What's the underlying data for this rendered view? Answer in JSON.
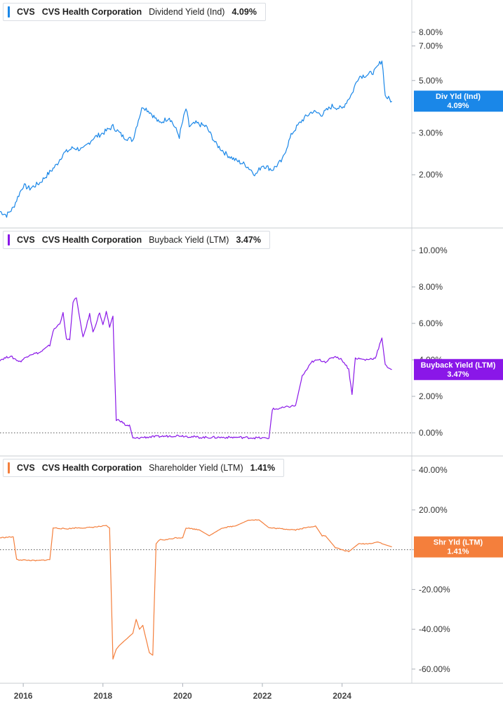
{
  "panels": [
    {
      "ticker": "CVS",
      "company": "CVS Health Corporation",
      "metric": "Dividend Yield (Ind)",
      "value": "4.09%",
      "badge_line1": "Div Yld (Ind)",
      "badge_line2": "4.09%",
      "color": "#1a87e8",
      "swatch_color": "#1a87e8"
    },
    {
      "ticker": "CVS",
      "company": "CVS Health Corporation",
      "metric": "Buyback Yield (LTM)",
      "value": "3.47%",
      "badge_line1": "Buyback Yield (LTM)",
      "badge_line2": "3.47%",
      "color": "#8a17e8",
      "swatch_color": "#8a17e8"
    },
    {
      "ticker": "CVS",
      "company": "CVS Health Corporation",
      "metric": "Shareholder Yield (LTM)",
      "value": "1.41%",
      "badge_line1": "Shr Yld (LTM)",
      "badge_line2": "1.41%",
      "color": "#f47f3c",
      "swatch_color": "#f47f3c"
    }
  ],
  "chart_data": [
    {
      "type": "line",
      "scale": "log",
      "title": "CVS   CVS Health Corporation   Dividend Yield (Ind)   4.09%",
      "series": [
        {
          "name": "Dividend Yield (Ind)",
          "x": [
            "2015-06",
            "2015-08",
            "2015-10",
            "2016-01",
            "2016-03",
            "2016-06",
            "2016-09",
            "2016-11",
            "2017-01",
            "2017-04",
            "2017-07",
            "2017-10",
            "2018-01",
            "2018-04",
            "2018-07",
            "2018-10",
            "2019-01",
            "2019-03",
            "2019-06",
            "2019-09",
            "2019-12",
            "2020-02",
            "2020-03",
            "2020-05",
            "2020-08",
            "2020-11",
            "2021-02",
            "2021-05",
            "2021-08",
            "2021-11",
            "2022-01",
            "2022-04",
            "2022-07",
            "2022-10",
            "2023-01",
            "2023-04",
            "2023-07",
            "2023-10",
            "2024-01",
            "2024-04",
            "2024-06",
            "2024-09",
            "2024-11",
            "2025-01",
            "2025-02",
            "2025-04"
          ],
          "values": [
            1.4,
            1.35,
            1.45,
            1.8,
            1.75,
            1.85,
            2.05,
            2.2,
            2.45,
            2.6,
            2.55,
            2.85,
            3.0,
            3.2,
            2.9,
            2.8,
            3.9,
            3.7,
            3.3,
            3.5,
            2.9,
            3.8,
            3.2,
            3.3,
            3.2,
            2.7,
            2.45,
            2.3,
            2.2,
            2.0,
            2.2,
            2.1,
            2.3,
            3.0,
            3.4,
            3.7,
            3.6,
            3.9,
            3.8,
            4.4,
            5.2,
            5.3,
            5.5,
            6.1,
            4.3,
            4.09
          ]
        }
      ],
      "y_ticks": [
        2,
        3,
        5,
        7,
        8
      ],
      "y_tick_labels": [
        "2.00%",
        "3.00%",
        "5.00%",
        "7.00%",
        "8.00%"
      ],
      "ylim": [
        1.25,
        10.5
      ],
      "last_value": 4.09
    },
    {
      "type": "line",
      "scale": "linear",
      "title": "CVS   CVS Health Corporation   Buyback Yield (LTM)   3.47%",
      "series": [
        {
          "name": "Buyback Yield (LTM)",
          "x": [
            "2015-06",
            "2015-09",
            "2015-12",
            "2016-03",
            "2016-06",
            "2016-09",
            "2016-10",
            "2016-12",
            "2017-01",
            "2017-02",
            "2017-03",
            "2017-04",
            "2017-05",
            "2017-07",
            "2017-09",
            "2017-10",
            "2017-12",
            "2018-01",
            "2018-02",
            "2018-03",
            "2018-04",
            "2018-05",
            "2018-06",
            "2018-08",
            "2018-09",
            "2018-10",
            "2018-11",
            "2019-01",
            "2019-06",
            "2019-12",
            "2020-06",
            "2020-12",
            "2021-06",
            "2021-12",
            "2022-03",
            "2022-04",
            "2022-05",
            "2022-08",
            "2022-11",
            "2023-01",
            "2023-04",
            "2023-06",
            "2023-08",
            "2023-11",
            "2024-01",
            "2024-03",
            "2024-04",
            "2024-05",
            "2024-08",
            "2024-11",
            "2025-01",
            "2025-02",
            "2025-04"
          ],
          "values": [
            4.0,
            4.2,
            3.9,
            4.3,
            4.4,
            4.8,
            5.6,
            6.0,
            6.6,
            5.1,
            5.1,
            7.2,
            7.4,
            5.2,
            6.5,
            5.5,
            6.6,
            5.9,
            6.6,
            5.8,
            6.4,
            0.7,
            0.7,
            0.4,
            0.4,
            -0.3,
            -0.3,
            -0.25,
            -0.2,
            -0.15,
            -0.25,
            -0.25,
            -0.25,
            -0.28,
            -0.3,
            1.3,
            1.3,
            1.4,
            1.5,
            3.1,
            3.9,
            4.0,
            3.9,
            4.2,
            4.0,
            3.5,
            2.1,
            4.1,
            4.0,
            4.1,
            5.2,
            3.7,
            3.47
          ]
        }
      ],
      "y_ticks": [
        0,
        2,
        4,
        6,
        8,
        10
      ],
      "y_tick_labels": [
        "0.00%",
        "2.00%",
        "4.00%",
        "6.00%",
        "8.00%",
        "10.00%"
      ],
      "ylim": [
        -1,
        11
      ],
      "zero_line": true,
      "last_value": 3.47
    },
    {
      "type": "line",
      "scale": "linear",
      "title": "CVS   CVS Health Corporation   Shareholder Yield (LTM)   1.41%",
      "series": [
        {
          "name": "Shareholder Yield (LTM)",
          "x": [
            "2015-06",
            "2015-10",
            "2015-11",
            "2016-05",
            "2016-09",
            "2016-10",
            "2017-02",
            "2017-05",
            "2017-08",
            "2017-11",
            "2018-02",
            "2018-03",
            "2018-04",
            "2018-05",
            "2018-06",
            "2018-08",
            "2018-10",
            "2018-11",
            "2018-12",
            "2019-01",
            "2019-03",
            "2019-04",
            "2019-05",
            "2019-06",
            "2019-08",
            "2019-11",
            "2020-01",
            "2020-02",
            "2020-06",
            "2020-09",
            "2021-01",
            "2021-05",
            "2021-09",
            "2021-12",
            "2022-03",
            "2022-07",
            "2022-11",
            "2023-02",
            "2023-05",
            "2023-07",
            "2023-08",
            "2023-11",
            "2024-01",
            "2024-03",
            "2024-06",
            "2024-09",
            "2024-12",
            "2025-01",
            "2025-04"
          ],
          "values": [
            6,
            6.5,
            -5,
            -5.5,
            -5,
            11,
            10.5,
            11,
            11,
            11.5,
            12,
            11,
            -55,
            -50,
            -48,
            -45,
            -42,
            -35,
            -40,
            -38,
            -52,
            -53,
            3,
            5,
            5,
            6,
            6,
            11,
            10,
            7,
            11,
            12,
            15,
            15,
            11,
            10.5,
            10,
            11,
            12,
            7,
            7,
            1,
            0,
            -1,
            3,
            3,
            4,
            3,
            1.41
          ]
        }
      ],
      "y_ticks": [
        -60,
        -40,
        -20,
        0,
        20,
        40
      ],
      "y_tick_labels": [
        "-60.00%",
        "-40.00%",
        "-20.00%",
        "0.00%",
        "20.00%",
        "40.00%"
      ],
      "ylim": [
        -65,
        45
      ],
      "zero_line": true,
      "last_value": 1.41
    }
  ],
  "x_axis": {
    "range": [
      "2015-06",
      "2025-10"
    ],
    "ticks": [
      "2016-01",
      "2018-01",
      "2020-01",
      "2022-01",
      "2024-01"
    ],
    "tick_labels": [
      "2016",
      "2018",
      "2020",
      "2022",
      "2024"
    ]
  }
}
